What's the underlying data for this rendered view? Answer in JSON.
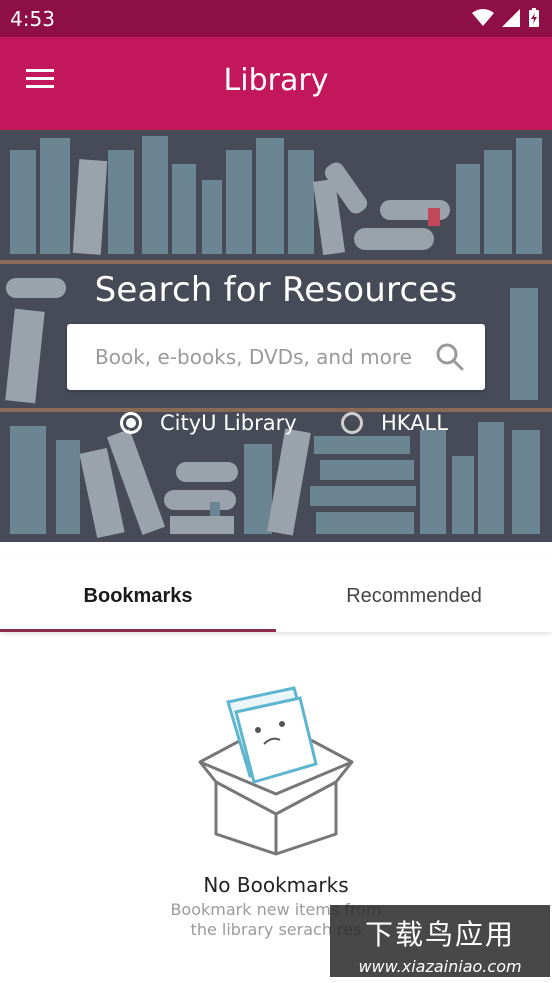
{
  "status_bar": {
    "time": "4:53"
  },
  "app_bar": {
    "title": "Library",
    "menu_icon": "hamburger-menu-icon"
  },
  "hero": {
    "title": "Search for Resources",
    "search": {
      "placeholder": "Book, e-books, DVDs, and more",
      "value": "",
      "icon": "search-icon"
    },
    "options": [
      {
        "label": "CityU Library",
        "selected": true
      },
      {
        "label": "HKALL",
        "selected": false
      }
    ]
  },
  "tabs": [
    {
      "label": "Bookmarks",
      "active": true
    },
    {
      "label": "Recommended",
      "active": false
    }
  ],
  "empty_state": {
    "icon": "empty-box-book-icon",
    "title": "No Bookmarks",
    "line1": "Bookmark new items from",
    "line2": "the library serach res"
  },
  "watermark": {
    "text": "下载鸟应用",
    "url": "www.xiazainiao.com"
  },
  "colors": {
    "status_bar": "#8e0f45",
    "app_bar": "#c2185b",
    "hero_bg": "#474b57",
    "tab_indicator": "#8e2a4e"
  }
}
